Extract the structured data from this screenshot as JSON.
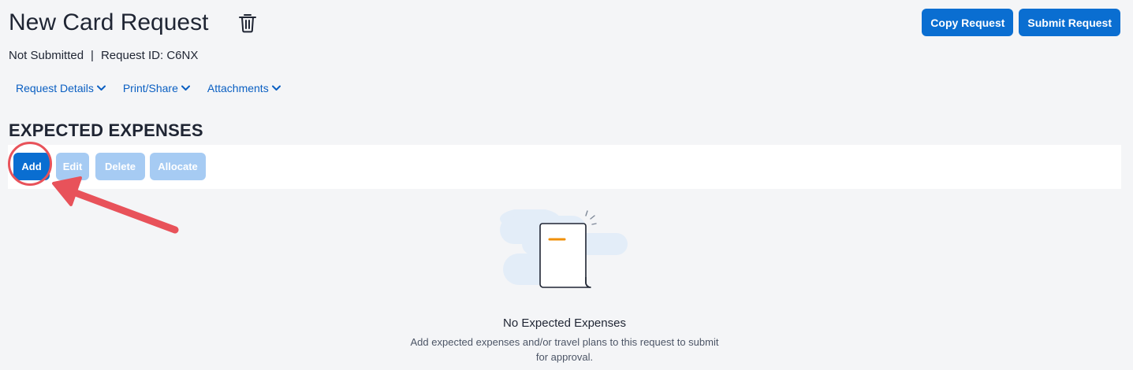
{
  "header": {
    "title": "New Card Request",
    "copy_label": "Copy Request",
    "submit_label": "Submit Request"
  },
  "status": {
    "state": "Not Submitted",
    "separator": "|",
    "request_id": "Request ID: C6NX"
  },
  "subnav": {
    "items": [
      {
        "label": "Request Details",
        "icon": "chevron-down-icon"
      },
      {
        "label": "Print/Share",
        "icon": "chevron-down-icon"
      },
      {
        "label": "Attachments",
        "icon": "chevron-down-icon"
      }
    ]
  },
  "expenses": {
    "title": "EXPECTED EXPENSES",
    "toolbar": {
      "add_label": "Add",
      "edit_label": "Edit",
      "delete_label": "Delete",
      "allocate_label": "Allocate"
    },
    "empty_state": {
      "title": "No Expected Expenses",
      "description": "Add expected expenses and/or travel plans to this request to submit for approval."
    }
  },
  "colors": {
    "primary": "#0a6ed1",
    "disabled": "#a6cbf3",
    "link": "#0a5fc2",
    "annotation": "#e8525a",
    "background": "#f4f5f7"
  }
}
